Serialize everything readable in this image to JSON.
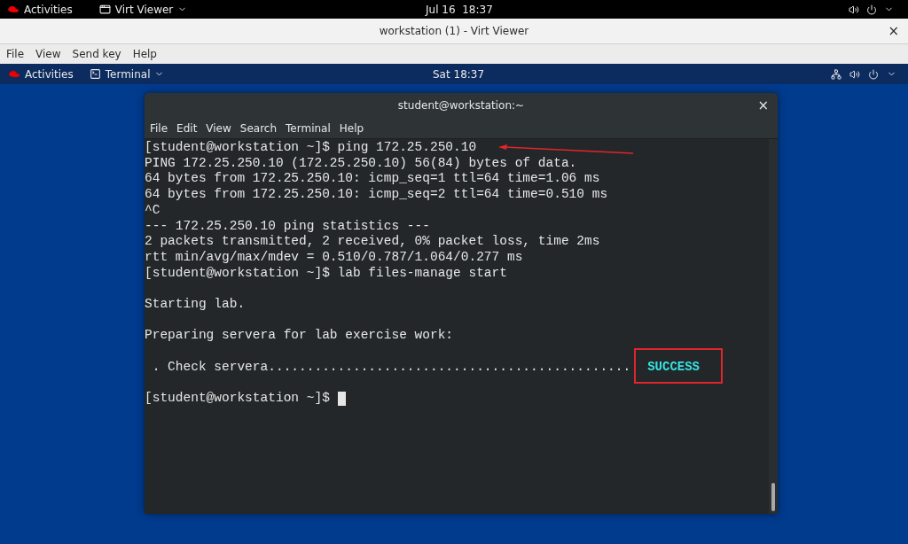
{
  "host_bar": {
    "activities": "Activities",
    "app_menu": "Virt Viewer",
    "clock": "Jul 16  18:37"
  },
  "viewer_window": {
    "title": "workstation (1) - Virt Viewer",
    "close": "×",
    "menu": [
      "File",
      "View",
      "Send key",
      "Help"
    ]
  },
  "guest_bar": {
    "activities": "Activities",
    "app_menu": "Terminal",
    "clock": "Sat 18:37"
  },
  "terminal": {
    "title": "student@workstation:~",
    "close": "×",
    "menu": [
      "File",
      "Edit",
      "View",
      "Search",
      "Terminal",
      "Help"
    ],
    "lines": [
      {
        "kind": "text",
        "text": "[student@workstation ~]$ ping 172.25.250.10"
      },
      {
        "kind": "text",
        "text": "PING 172.25.250.10 (172.25.250.10) 56(84) bytes of data."
      },
      {
        "kind": "text",
        "text": "64 bytes from 172.25.250.10: icmp_seq=1 ttl=64 time=1.06 ms"
      },
      {
        "kind": "text",
        "text": "64 bytes from 172.25.250.10: icmp_seq=2 ttl=64 time=0.510 ms"
      },
      {
        "kind": "text",
        "text": "^C"
      },
      {
        "kind": "text",
        "text": "--- 172.25.250.10 ping statistics ---"
      },
      {
        "kind": "text",
        "text": "2 packets transmitted, 2 received, 0% packet loss, time 2ms"
      },
      {
        "kind": "text",
        "text": "rtt min/avg/max/mdev = 0.510/0.787/1.064/0.277 ms"
      },
      {
        "kind": "text",
        "text": "[student@workstation ~]$ lab files-manage start"
      },
      {
        "kind": "blank"
      },
      {
        "kind": "text",
        "text": "Starting lab."
      },
      {
        "kind": "blank"
      },
      {
        "kind": "text",
        "text": "Preparing servera for lab exercise work:"
      },
      {
        "kind": "blank"
      },
      {
        "kind": "check",
        "text": " . Check servera...............................................",
        "status": "SUCCESS"
      },
      {
        "kind": "blank"
      },
      {
        "kind": "prompt",
        "text": "[student@workstation ~]$"
      }
    ]
  }
}
